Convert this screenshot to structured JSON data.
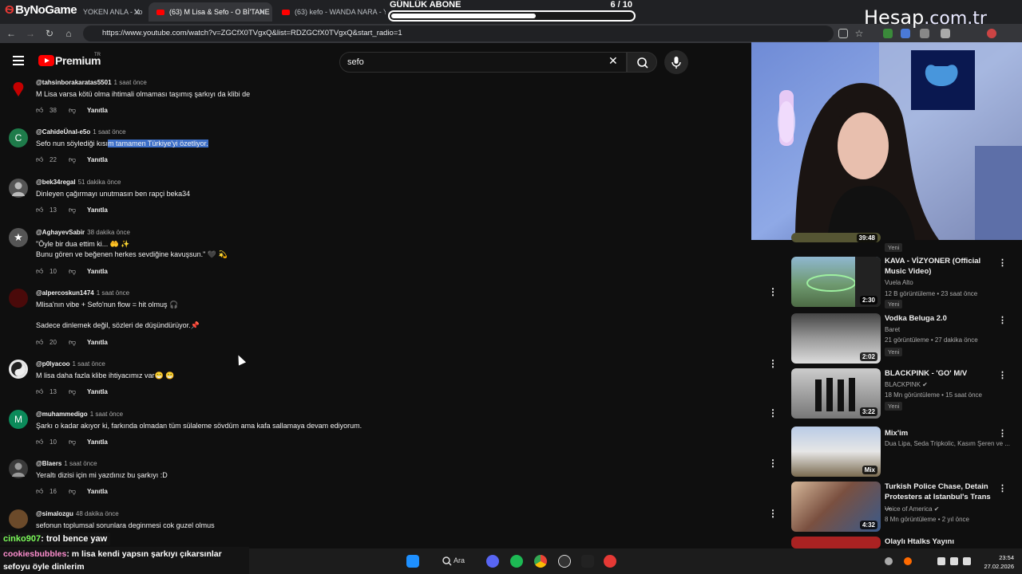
{
  "browser": {
    "logo": "ByNoGame",
    "tabs": [
      {
        "label": "YOKEN ANLA - Yo"
      },
      {
        "label": "(63) M Lisa & Sefo - O Bİ'TANE"
      },
      {
        "label": "(63) kefo - WANDA NARA - Yo"
      }
    ],
    "url": "https://www.youtube.com/watch?v=ZGCfX0TVgxQ&list=RDZGCfX0TVgxQ&start_radio=1"
  },
  "overlay": {
    "sub_goal_label": "GÜNLÜK ABONE",
    "sub_goal_count": "6  / 10",
    "sub_goal_progress": 0.6,
    "brand": "Hesap",
    "brand_suffix": ".com.tr"
  },
  "youtube": {
    "premium": "Premium",
    "region": "TR",
    "search_query": "sefo"
  },
  "comments": [
    {
      "author": "@tahsinborakaratas5501",
      "time": "1 saat önce",
      "text": "M Lisa varsa kötü olma ihtimali olmaması taşımış şarkıyı da klibi de",
      "likes": "38",
      "reply": "Yanıtla",
      "avatar_color": "#c40000",
      "initial": ""
    },
    {
      "author": "@CahideÜnal-e5o",
      "time": "1 saat önce",
      "text_before": "Sefo nun söylediği kısı",
      "text_selected": "m tamamen Türkiye'yi özetliyor.",
      "likes": "22",
      "reply": "Yanıtla",
      "avatar_color": "#1e7b4a",
      "initial": "C"
    },
    {
      "author": "@bek34regal",
      "time": "51 dakika önce",
      "text": "Dinleyen çağırmayı unutmasın ben rapçi beka34",
      "likes": "13",
      "reply": "Yanıtla",
      "avatar_color": "#555555",
      "initial": ""
    },
    {
      "author": "@AghayevSabir",
      "time": "38 dakika önce",
      "text": "\"Öyle bir dua ettim ki... 🤲 ✨\nBunu gören ve beğenen herkes sevdiğine kavuşsun.\" 🖤 💫",
      "likes": "10",
      "reply": "Yanıtla",
      "avatar_color": "#666666",
      "initial": "★"
    },
    {
      "author": "@alpercoskun1474",
      "time": "1 saat önce",
      "text": "Mlisa'nın vibe + Sefo'nun flow = hit olmuş 🎧\n\nSadece dinlemek değil, sözleri de düşündürüyor.📌",
      "likes": "20",
      "reply": "Yanıtla",
      "avatar_color": "#6b0d0d",
      "initial": ""
    },
    {
      "author": "@p0lyacoo",
      "time": "1 saat önce",
      "text": "M lisa daha fazla klibe ihtiyacımız var😁 😁",
      "likes": "13",
      "reply": "Yanıtla",
      "avatar_color": "#dddddd",
      "initial": ""
    },
    {
      "author": "@muhammedigo",
      "time": "1 saat önce",
      "text": "Şarkı o kadar akıyor ki, farkında olmadan tüm sülaleme sövdüm ama kafa sallamaya devam ediyorum.",
      "likes": "10",
      "reply": "Yanıtla",
      "avatar_color": "#0b8a5a",
      "initial": "M"
    },
    {
      "author": "@Blaers",
      "time": "1 saat önce",
      "text": "Yeraltı dizisi için mi yazdınız bu şarkıyı :D",
      "likes": "16",
      "reply": "Yanıtla",
      "avatar_color": "#444444",
      "initial": ""
    },
    {
      "author": "@simalozgu",
      "time": "48 dakika önce",
      "text": "sefonun toplumsal sorunlara deginmesi cok guzel olmus",
      "likes": "",
      "reply": "Yanıtla",
      "avatar_color": "#6b4a2a",
      "initial": ""
    }
  ],
  "chat": [
    {
      "user": "cinko907",
      "text": ": trol bence yaw"
    },
    {
      "user": "cookiesbubbles",
      "text": ": m lisa kendi yapsın şarkıyı çıkarsınlar sefoyu öyle dinlerim"
    }
  ],
  "recommendations": [
    {
      "title": "",
      "channel": "",
      "meta": "",
      "badge": "Yeni",
      "duration": "39:48"
    },
    {
      "title": "KAVA - VİZYONER (Official Music Video)",
      "channel": "Vuela Alto",
      "meta": "12 B görüntüleme • 23 saat önce",
      "badge": "Yeni",
      "duration": "2:30"
    },
    {
      "title": "Vodka Beluga 2.0",
      "channel": "Baret",
      "meta": "21 görüntüleme • 27 dakika önce",
      "badge": "Yeni",
      "duration": "2:02"
    },
    {
      "title": "BLACKPINK - 'GO' M/V",
      "channel": "BLACKPINK ✔",
      "meta": "18 Mn görüntüleme • 15 saat önce",
      "badge": "Yeni",
      "duration": "3:22"
    },
    {
      "title": "Mix'im",
      "channel": "Dua Lipa, Seda Tripkolic, Kasım Şeren ve ...",
      "meta": "",
      "badge": "",
      "duration": "Mix"
    },
    {
      "title": "Turkish Police Chase, Detain Protesters at Istanbul's Trans ...",
      "channel": "Voice of America ✔",
      "meta": "8 Mn görüntüleme • 2 yıl önce",
      "badge": "",
      "duration": "4:32"
    },
    {
      "title": "Olaylı Htalks Yayını",
      "channel": "",
      "meta": "",
      "badge": "",
      "duration": ""
    }
  ],
  "taskbar": {
    "search_label": "Ara",
    "time": "23:54",
    "date": "27.02.2026"
  }
}
